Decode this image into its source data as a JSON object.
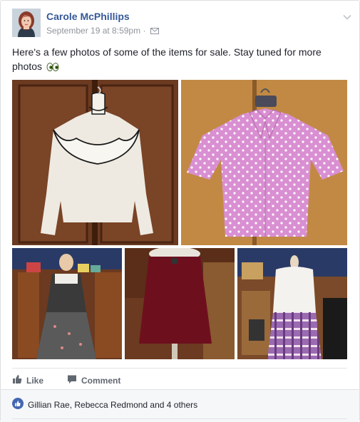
{
  "post": {
    "author": "Carole McPhillips",
    "timestamp": "September 19 at 8:59pm",
    "separator": "·",
    "text": "Here's a few photos of some of the items for sale. Stay tuned for more photos",
    "privacy_icon": "envelope-icon",
    "emoji_icon": "eyes-emoji-icon"
  },
  "photos": [
    {
      "alt": "white ruffled blouse"
    },
    {
      "alt": "pink polka dot shirt"
    },
    {
      "alt": "floral dress on mannequin"
    },
    {
      "alt": "burgundy suede skirt"
    },
    {
      "alt": "purple plaid skirt on mannequin"
    }
  ],
  "actions": {
    "like_label": "Like",
    "comment_label": "Comment"
  },
  "reactions": {
    "summary": "Gillian Rae, Rebecca Redmond and 4 others"
  },
  "colors": {
    "link": "#365899",
    "meta": "#90949c",
    "action": "#616770",
    "like_blue": "#4267b2"
  }
}
